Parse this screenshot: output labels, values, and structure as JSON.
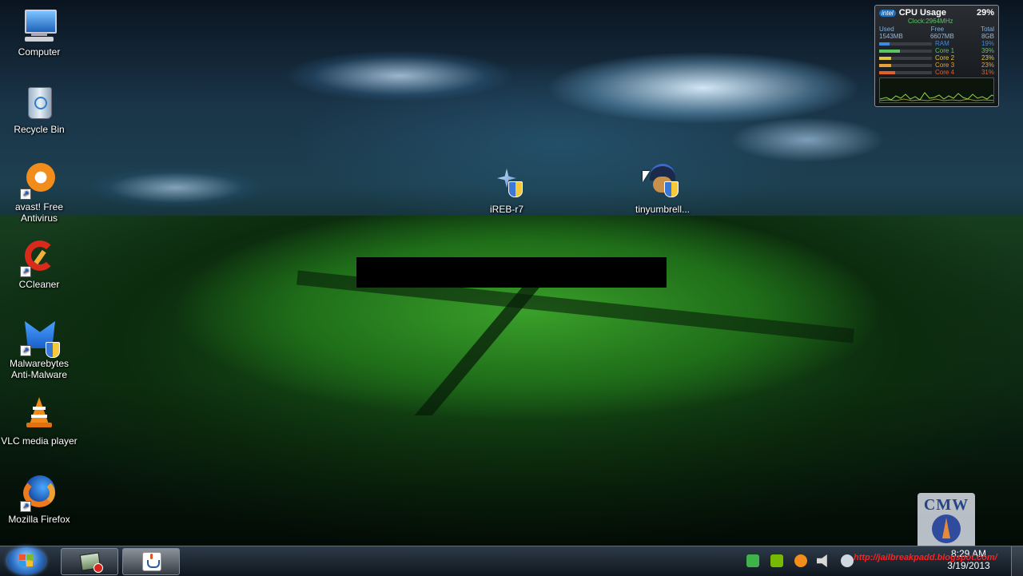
{
  "desktop": {
    "icons": [
      {
        "label": "Computer",
        "icon": "computer-icon"
      },
      {
        "label": "Recycle Bin",
        "icon": "recycle-bin-icon"
      },
      {
        "label": "avast! Free Antivirus",
        "icon": "avast-icon"
      },
      {
        "label": "CCleaner",
        "icon": "ccleaner-icon"
      },
      {
        "label": "Malwarebytes Anti-Malware",
        "icon": "malwarebytes-icon"
      },
      {
        "label": "VLC media player",
        "icon": "vlc-icon"
      },
      {
        "label": "Mozilla Firefox",
        "icon": "firefox-icon"
      },
      {
        "label": "iREB-r7",
        "icon": "ireb-icon"
      },
      {
        "label": "tinyumbrell...",
        "icon": "tinyumbrella-icon"
      }
    ]
  },
  "gadget": {
    "brand": "intel",
    "title": "CPU Usage",
    "percent": "29%",
    "clock": "Clock:2964MHz",
    "col_used": "Used",
    "col_free": "Free",
    "col_total": "Total",
    "used": "1543MB",
    "free": "6607MB",
    "total": "8GB",
    "meters": [
      {
        "label": "RAM",
        "value": "19%",
        "fraction": 0.19,
        "color": "#3d8ae0"
      },
      {
        "label": "Core 1",
        "value": "39%",
        "fraction": 0.39,
        "color": "#58c760"
      },
      {
        "label": "Core 2",
        "value": "23%",
        "fraction": 0.23,
        "color": "#e0c640"
      },
      {
        "label": "Core 3",
        "value": "23%",
        "fraction": 0.23,
        "color": "#e6a23a"
      },
      {
        "label": "Core 4",
        "value": "31%",
        "fraction": 0.31,
        "color": "#e0602a"
      }
    ]
  },
  "watermark": {
    "text": "CMW"
  },
  "taskbar": {
    "time": "8:29 AM",
    "date": "3/19/2013",
    "overlay": "http://jailbreakpadd.blogspot.com/",
    "buttons": [
      {
        "name": "taskbar-app-1",
        "icon": "app-window-icon"
      },
      {
        "name": "taskbar-java",
        "icon": "java-icon"
      }
    ]
  },
  "colors": {
    "taskbar": "#1a2430",
    "gadget_accent": "#58c760"
  }
}
